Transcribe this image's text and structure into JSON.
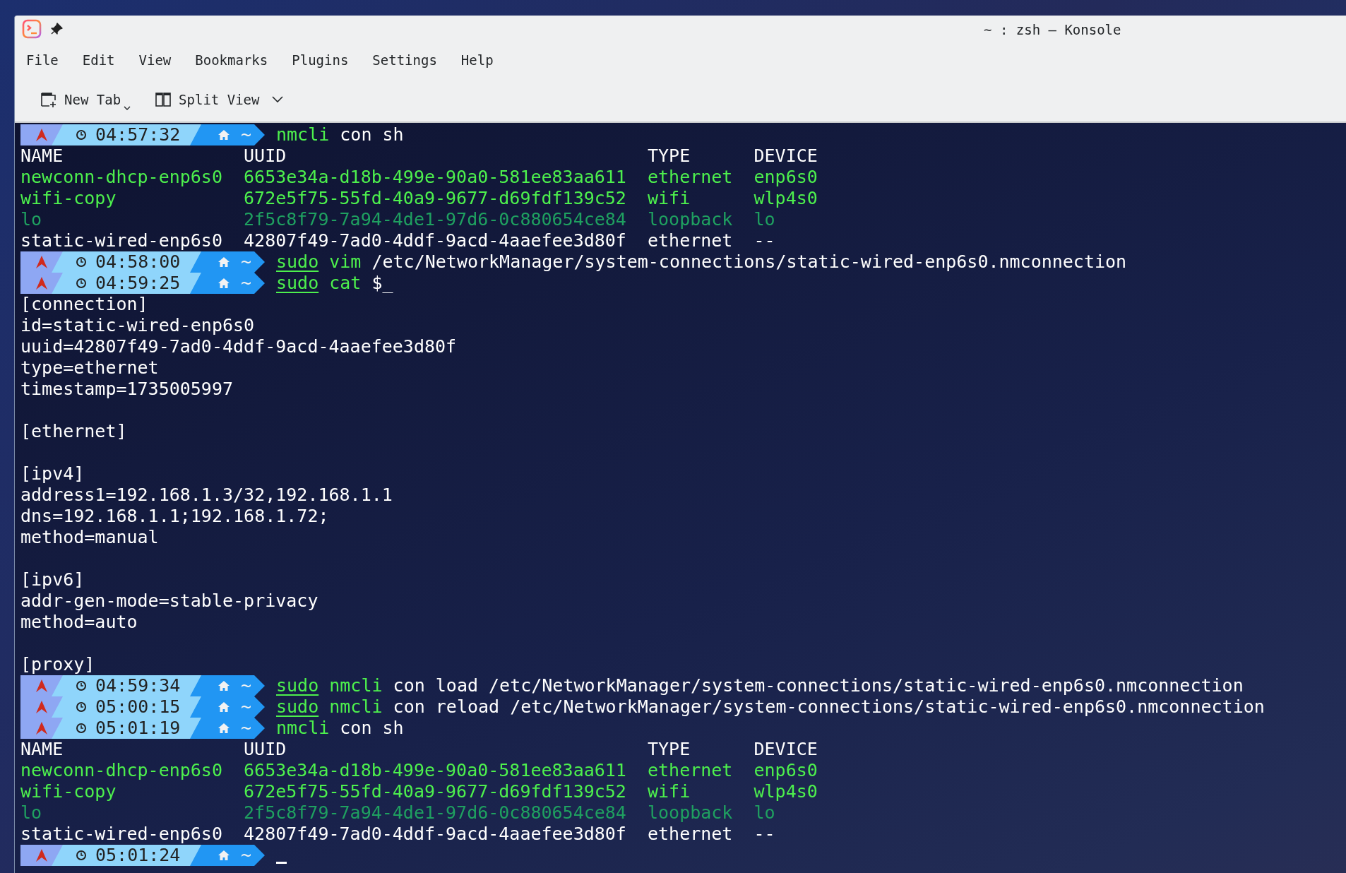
{
  "window": {
    "title": "~ : zsh — Konsole"
  },
  "menu": [
    "File",
    "Edit",
    "View",
    "Bookmarks",
    "Plugins",
    "Settings",
    "Help"
  ],
  "toolbar": [
    {
      "label": "New Tab",
      "kind": "new-tab"
    },
    {
      "label": "Split View",
      "kind": "split-view"
    }
  ],
  "terminal": {
    "lines": [
      {
        "kind": "prompt",
        "time": "04:57:32",
        "dir": "~",
        "cursor": false,
        "command": [
          {
            "text": "nmcli",
            "kind": "command"
          },
          {
            "text": "con sh",
            "kind": "args"
          }
        ]
      },
      {
        "kind": "row",
        "color": "#ffffff",
        "cells": [
          "NAME",
          "UUID",
          "TYPE",
          "DEVICE"
        ]
      },
      {
        "kind": "row",
        "color": "#4df04d",
        "cells": [
          "newconn-dhcp-enp6s0",
          "6653e34a-d18b-499e-90a0-581ee83aa611",
          "ethernet",
          "enp6s0"
        ]
      },
      {
        "kind": "row",
        "color": "#4df04d",
        "cells": [
          "wifi-copy",
          "672e5f75-55fd-40a9-9677-d69fdf139c52",
          "wifi",
          "wlp4s0"
        ]
      },
      {
        "kind": "row",
        "color": "#1fa060",
        "cells": [
          "lo",
          "2f5c8f79-7a94-4de1-97d6-0c880654ce84",
          "loopback",
          "lo"
        ]
      },
      {
        "kind": "row",
        "color": "#ffffff",
        "cells": [
          "static-wired-enp6s0",
          "42807f49-7ad0-4ddf-9acd-4aaefee3d80f",
          "ethernet",
          "--"
        ]
      },
      {
        "kind": "prompt",
        "time": "04:58:00",
        "dir": "~",
        "cursor": false,
        "command": [
          {
            "text": "sudo",
            "kind": "precommand"
          },
          {
            "text": "vim",
            "kind": "command"
          },
          {
            "text": "/etc/NetworkManager/system-connections/static-wired-enp6s0.nmconnection",
            "kind": "args"
          }
        ]
      },
      {
        "kind": "prompt",
        "time": "04:59:25",
        "dir": "~",
        "cursor": false,
        "command": [
          {
            "text": "sudo",
            "kind": "precommand"
          },
          {
            "text": "cat",
            "kind": "command"
          },
          {
            "text": "$_",
            "kind": "args"
          }
        ]
      },
      {
        "kind": "text",
        "text": "[connection]"
      },
      {
        "kind": "text",
        "text": "id=static-wired-enp6s0"
      },
      {
        "kind": "text",
        "text": "uuid=42807f49-7ad0-4ddf-9acd-4aaefee3d80f"
      },
      {
        "kind": "text",
        "text": "type=ethernet"
      },
      {
        "kind": "text",
        "text": "timestamp=1735005997"
      },
      {
        "kind": "blank"
      },
      {
        "kind": "text",
        "text": "[ethernet]"
      },
      {
        "kind": "blank"
      },
      {
        "kind": "text",
        "text": "[ipv4]"
      },
      {
        "kind": "text",
        "text": "address1=192.168.1.3/32,192.168.1.1"
      },
      {
        "kind": "text",
        "text": "dns=192.168.1.1;192.168.1.72;"
      },
      {
        "kind": "text",
        "text": "method=manual"
      },
      {
        "kind": "blank"
      },
      {
        "kind": "text",
        "text": "[ipv6]"
      },
      {
        "kind": "text",
        "text": "addr-gen-mode=stable-privacy"
      },
      {
        "kind": "text",
        "text": "method=auto"
      },
      {
        "kind": "blank"
      },
      {
        "kind": "text",
        "text": "[proxy]"
      },
      {
        "kind": "prompt",
        "time": "04:59:34",
        "dir": "~",
        "cursor": false,
        "command": [
          {
            "text": "sudo",
            "kind": "precommand"
          },
          {
            "text": "nmcli",
            "kind": "command"
          },
          {
            "text": "con load /etc/NetworkManager/system-connections/static-wired-enp6s0.nmconnection",
            "kind": "args"
          }
        ]
      },
      {
        "kind": "prompt",
        "time": "05:00:15",
        "dir": "~",
        "cursor": false,
        "command": [
          {
            "text": "sudo",
            "kind": "precommand"
          },
          {
            "text": "nmcli",
            "kind": "command"
          },
          {
            "text": "con reload /etc/NetworkManager/system-connections/static-wired-enp6s0.nmconnection",
            "kind": "args"
          }
        ]
      },
      {
        "kind": "prompt",
        "time": "05:01:19",
        "dir": "~",
        "cursor": false,
        "command": [
          {
            "text": "nmcli",
            "kind": "command"
          },
          {
            "text": "con sh",
            "kind": "args"
          }
        ]
      },
      {
        "kind": "row",
        "color": "#ffffff",
        "cells": [
          "NAME",
          "UUID",
          "TYPE",
          "DEVICE"
        ]
      },
      {
        "kind": "row",
        "color": "#4df04d",
        "cells": [
          "newconn-dhcp-enp6s0",
          "6653e34a-d18b-499e-90a0-581ee83aa611",
          "ethernet",
          "enp6s0"
        ]
      },
      {
        "kind": "row",
        "color": "#4df04d",
        "cells": [
          "wifi-copy",
          "672e5f75-55fd-40a9-9677-d69fdf139c52",
          "wifi",
          "wlp4s0"
        ]
      },
      {
        "kind": "row",
        "color": "#1fa060",
        "cells": [
          "lo",
          "2f5c8f79-7a94-4de1-97d6-0c880654ce84",
          "loopback",
          "lo"
        ]
      },
      {
        "kind": "row",
        "color": "#ffffff",
        "cells": [
          "static-wired-enp6s0",
          "42807f49-7ad0-4ddf-9acd-4aaefee3d80f",
          "ethernet",
          "--"
        ]
      },
      {
        "kind": "prompt",
        "time": "05:01:24",
        "dir": "~",
        "cursor": true
      }
    ]
  }
}
